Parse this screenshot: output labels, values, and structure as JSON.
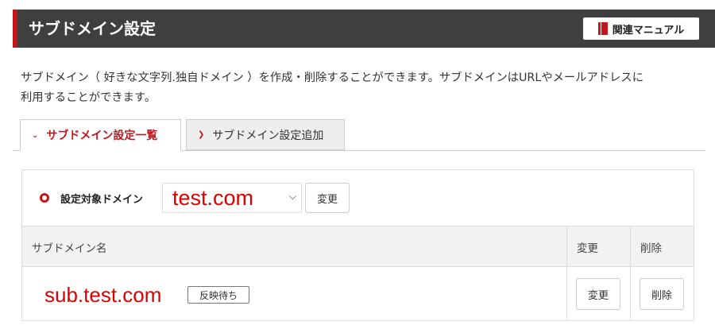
{
  "header": {
    "title": "サブドメイン設定",
    "manual_button": "関連マニュアル"
  },
  "description": {
    "line1": "サブドメイン（ 好きな文字列.独自ドメイン ）を作成・削除することができます。サブドメインはURLやメールアドレスに",
    "line2": "利用することができます。"
  },
  "tabs": [
    {
      "label": "サブドメイン設定一覧",
      "active": true
    },
    {
      "label": "サブドメイン設定追加",
      "active": false
    }
  ],
  "domain_selector": {
    "label": "設定対象ドメイン",
    "selected": "test.com",
    "change_button": "変更"
  },
  "table": {
    "columns": [
      "サブドメイン名",
      "変更",
      "削除"
    ],
    "rows": [
      {
        "subdomain": "sub.test.com",
        "status": "反映待ち",
        "change": "変更",
        "delete": "削除"
      }
    ]
  },
  "colors": {
    "accent": "#c4161c",
    "header_bg": "#3f3f3f",
    "highlight_text": "#d90000"
  }
}
